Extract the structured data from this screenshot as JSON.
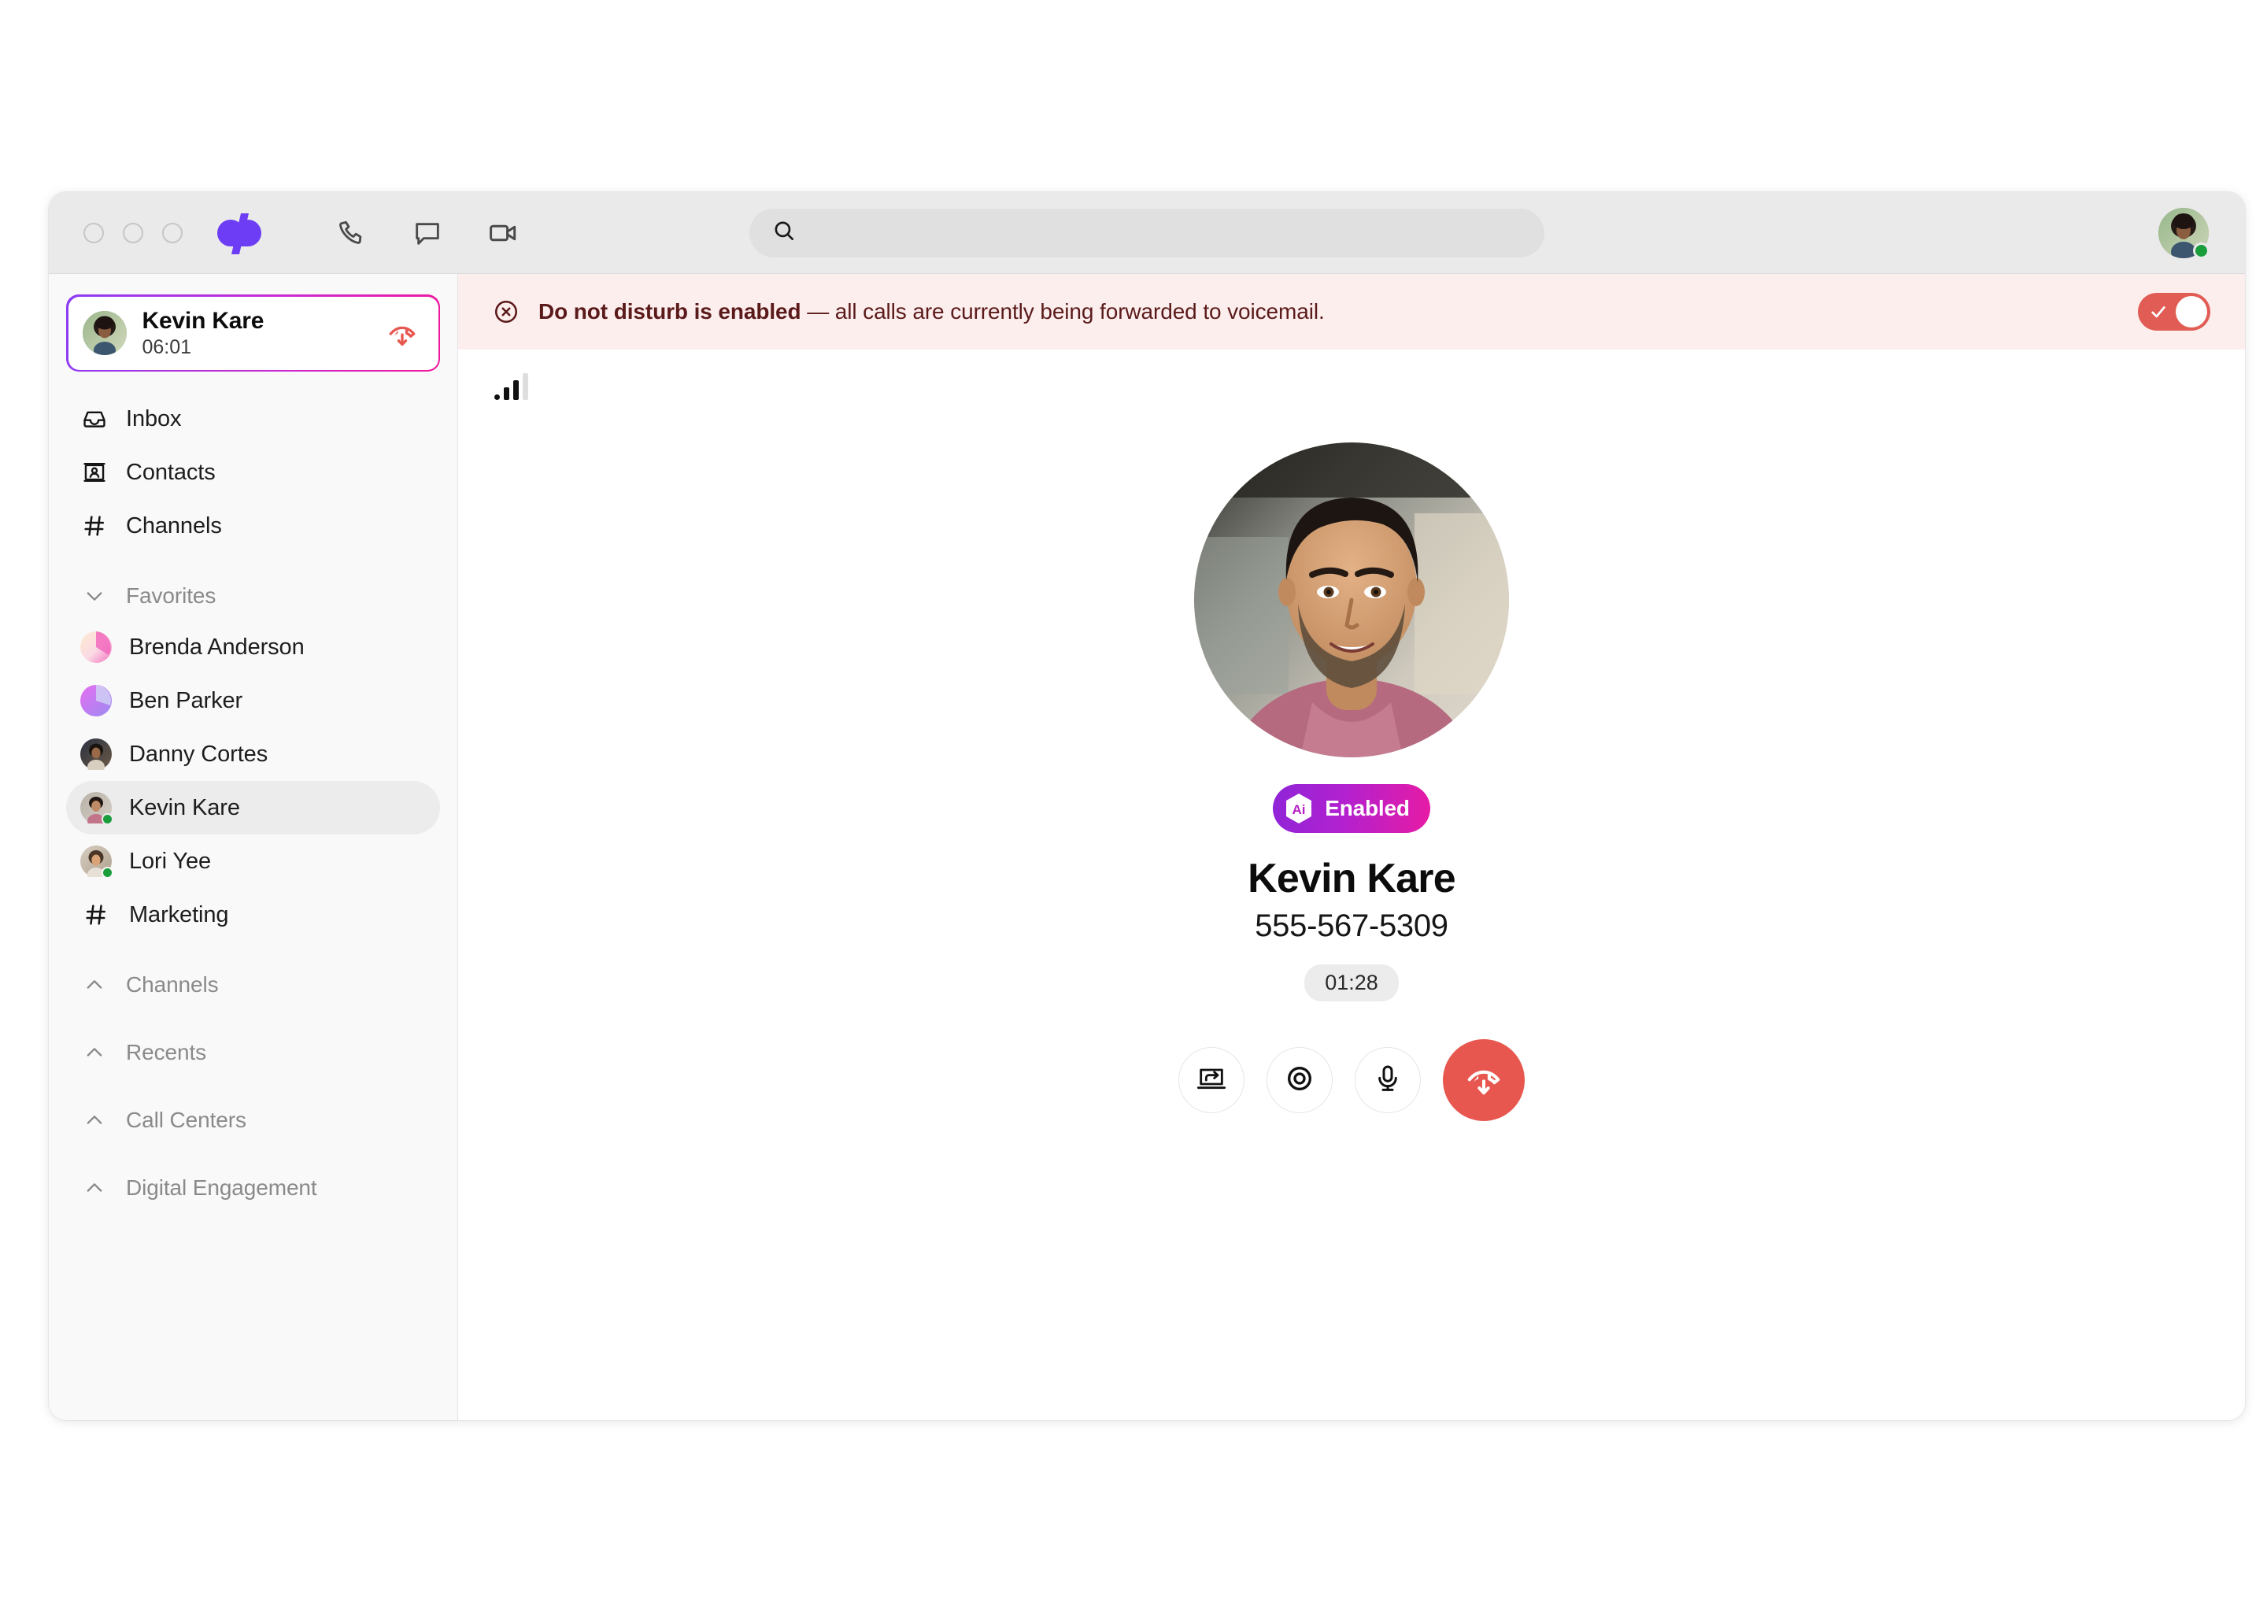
{
  "window": {
    "traffic_lights": [
      "close",
      "minimize",
      "maximize"
    ],
    "logo_name": "dialpad-logo"
  },
  "toolbar": {
    "icons": [
      {
        "name": "phone-icon",
        "label": "Call"
      },
      {
        "name": "chat-icon",
        "label": "Messages"
      },
      {
        "name": "video-icon",
        "label": "Video"
      }
    ],
    "search": {
      "value": "",
      "placeholder": ""
    },
    "user_avatar": {
      "name": "user-avatar",
      "presence": "online",
      "presence_color": "#1a9e3c"
    }
  },
  "sidebar": {
    "active_call": {
      "name": "Kevin Kare",
      "duration": "06:01",
      "hangup_icon": "hangup-icon",
      "border_gradient_from": "#8b3df4",
      "border_gradient_to": "#f0189c"
    },
    "nav": [
      {
        "label": "Inbox",
        "icon": "inbox-icon"
      },
      {
        "label": "Contacts",
        "icon": "contacts-icon"
      },
      {
        "label": "Channels",
        "icon": "hash-icon"
      }
    ],
    "favorites_section": {
      "label": "Favorites",
      "icon": "chevron-down-icon",
      "expanded": true
    },
    "favorites": [
      {
        "label": "Brenda Anderson",
        "avatar_type": "gradient",
        "avatar_from": "#fde9cf",
        "avatar_to": "#f26ec0",
        "presence": "none"
      },
      {
        "label": "Ben Parker",
        "avatar_type": "gradient",
        "avatar_from": "#e66ef0",
        "avatar_to": "#8b7df0",
        "presence": "none"
      },
      {
        "label": "Danny Cortes",
        "avatar_type": "photo",
        "avatar_from": "#2a3140",
        "avatar_to": "#8a6a4e",
        "presence": "none"
      },
      {
        "label": "Kevin Kare",
        "avatar_type": "photo",
        "avatar_from": "#b0a79c",
        "avatar_to": "#c1748a",
        "presence": "online",
        "selected": true
      },
      {
        "label": "Lori Yee",
        "avatar_type": "photo",
        "avatar_from": "#cfc7bb",
        "avatar_to": "#b98a70",
        "presence": "online"
      },
      {
        "label": "Marketing",
        "avatar_type": "hash",
        "presence": "none"
      }
    ],
    "sections": [
      {
        "label": "Channels",
        "icon": "chevron-up-icon",
        "expanded": false
      },
      {
        "label": "Recents",
        "icon": "chevron-up-icon",
        "expanded": false
      },
      {
        "label": "Call Centers",
        "icon": "chevron-up-icon",
        "expanded": false
      },
      {
        "label": "Digital Engagement",
        "icon": "chevron-up-icon",
        "expanded": false
      }
    ]
  },
  "banner": {
    "icon": "close-circle-icon",
    "bold_text": "Do not disturb is enabled",
    "rest_text": " — all calls are currently being forwarded to voicemail.",
    "toggle": {
      "name": "dnd-toggle",
      "state": "on",
      "color": "#e15c54"
    },
    "background": "#fdeeee",
    "text_color": "#5b1a1a"
  },
  "call": {
    "signal_strength": 3,
    "signal_bars_total": 4,
    "photo_name": "callee-photo",
    "ai_badge": {
      "label": "Enabled",
      "icon": "ai-hex-icon",
      "gradient_from": "#8f25d8",
      "gradient_to": "#e71ba4"
    },
    "name": "Kevin Kare",
    "number": "555-567-5309",
    "timer": "01:28",
    "controls": [
      {
        "name": "transfer-call-button",
        "icon": "screen-transfer-icon",
        "variant": "light"
      },
      {
        "name": "record-call-button",
        "icon": "record-icon",
        "variant": "light"
      },
      {
        "name": "mute-button",
        "icon": "microphone-icon",
        "variant": "light"
      },
      {
        "name": "end-call-button",
        "icon": "hangup-icon",
        "variant": "danger",
        "color": "#e8574f"
      }
    ]
  }
}
